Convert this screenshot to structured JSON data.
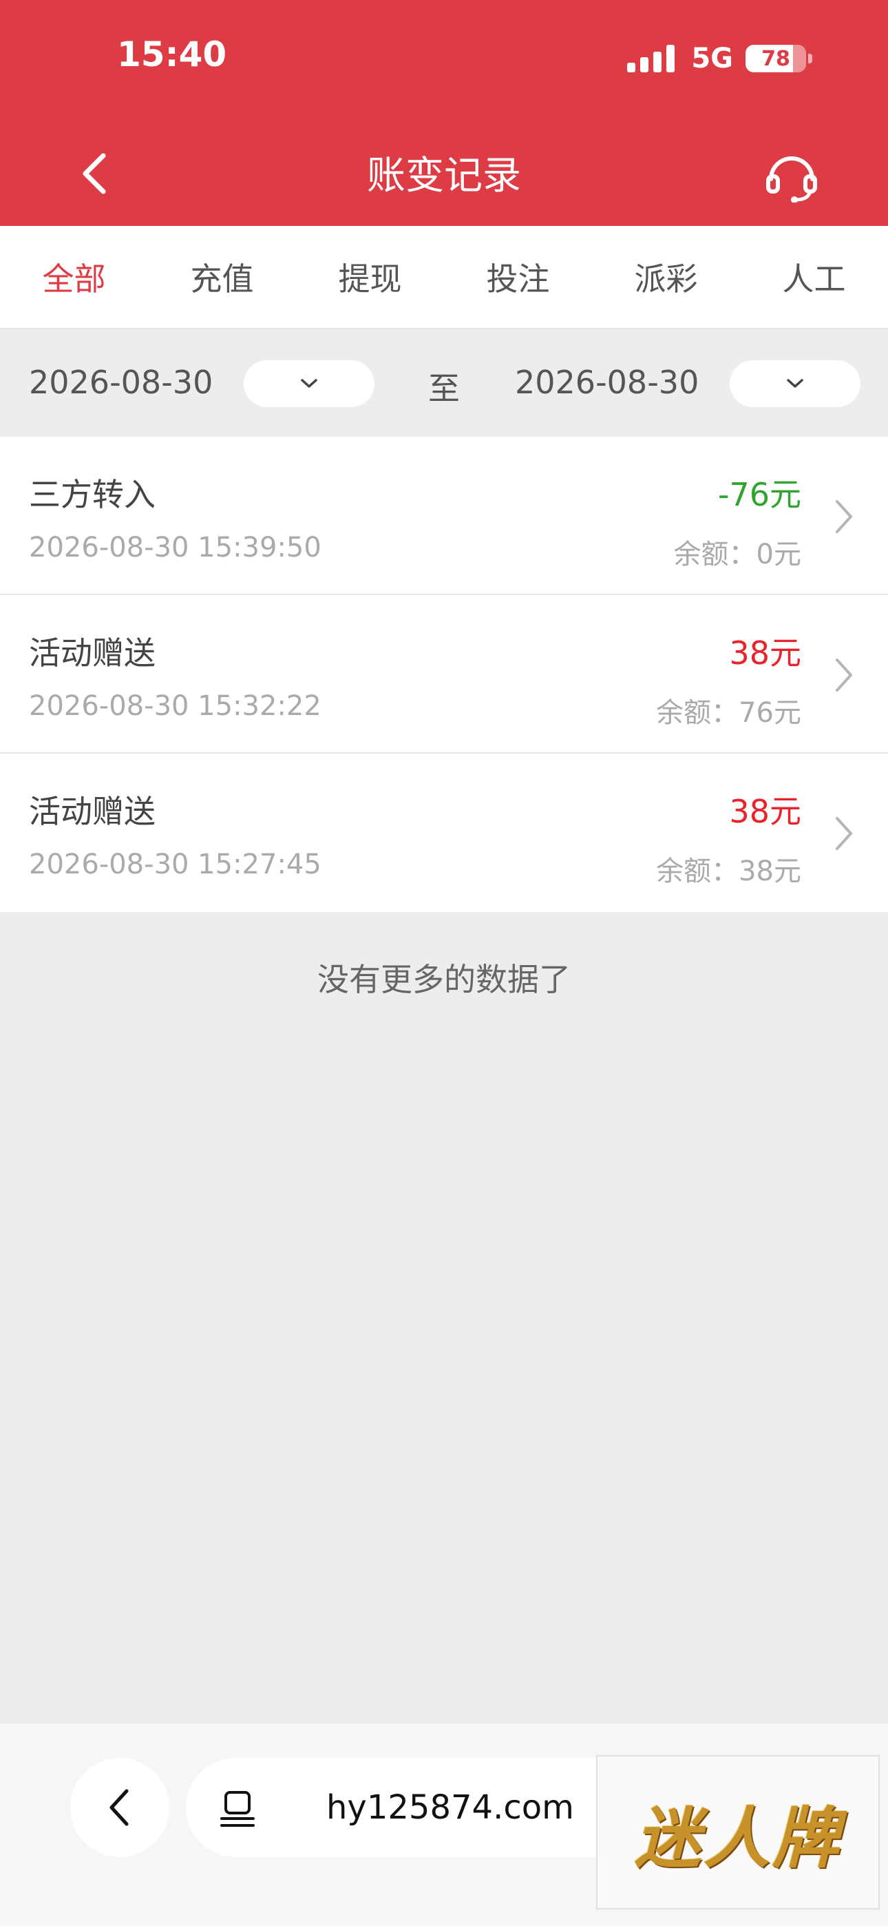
{
  "status_bar": {
    "time": "15:40",
    "network": "5G",
    "battery": "78",
    "battery_level": 0.78
  },
  "header": {
    "title": "账变记录",
    "back_icon": "chevron-left-icon",
    "support_icon": "headset-icon"
  },
  "tabs": [
    {
      "label": "全部",
      "active": true
    },
    {
      "label": "充值",
      "active": false
    },
    {
      "label": "提现",
      "active": false
    },
    {
      "label": "投注",
      "active": false
    },
    {
      "label": "派彩",
      "active": false
    },
    {
      "label": "人工",
      "active": false
    }
  ],
  "date_filter": {
    "start": "2026-08-30",
    "to_label": "至",
    "end": "2026-08-30"
  },
  "records": [
    {
      "title": "三方转入",
      "time": "2026-08-30 15:39:50",
      "amount": "-76元",
      "balance": "余额：0元",
      "amount_color": "#2fa52f"
    },
    {
      "title": "活动赠送",
      "time": "2026-08-30 15:32:22",
      "amount": "38元",
      "balance": "余额：76元",
      "amount_color": "#e8232b"
    },
    {
      "title": "活动赠送",
      "time": "2026-08-30 15:27:45",
      "amount": "38元",
      "balance": "余额：38元",
      "amount_color": "#e8232b"
    }
  ],
  "footer_text": "没有更多的数据了",
  "browser_bar": {
    "url": "hy125874.com",
    "brand": "迷人牌"
  },
  "colors": {
    "accent": "#de3c45",
    "negative": "#2fa52f",
    "positive": "#e8232b"
  }
}
